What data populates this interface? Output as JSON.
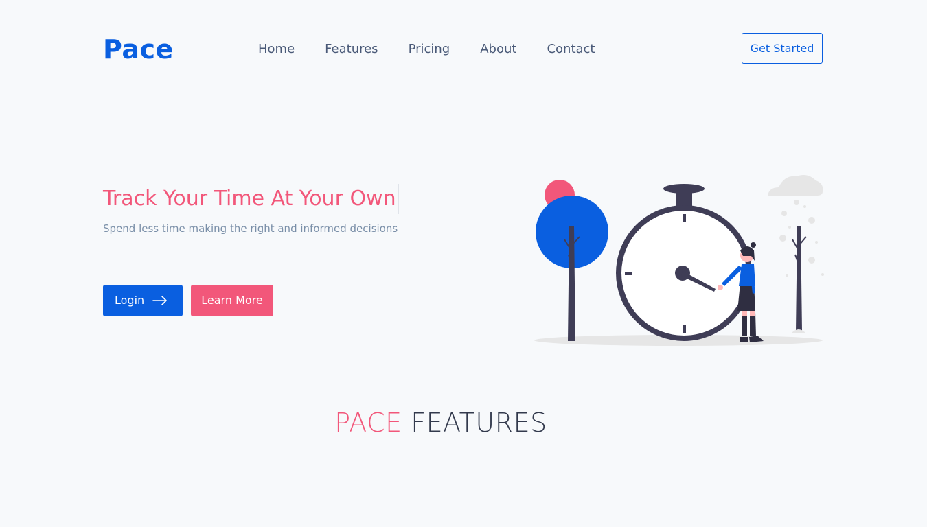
{
  "brand": {
    "name": "Pace"
  },
  "nav": {
    "items": [
      {
        "label": "Home"
      },
      {
        "label": "Features"
      },
      {
        "label": "Pricing"
      },
      {
        "label": "About"
      },
      {
        "label": "Contact"
      }
    ],
    "cta_label": "Get Started"
  },
  "hero": {
    "title": "Track Your Time At Your Own",
    "subtitle": "Spend less time making the right and informed decisions",
    "login_label": "Login",
    "learn_more_label": "Learn More"
  },
  "features": {
    "title_accent": "PACE",
    "title_rest": "FEATURES"
  },
  "colors": {
    "primary": "#0a5fe0",
    "accent": "#f2577a",
    "text_muted": "#7a8fa8",
    "nav_text": "#4a5a78",
    "dark": "#3f3d56",
    "background": "#f7f9fb"
  },
  "icons": {
    "login_arrow": "arrow-right-icon"
  }
}
